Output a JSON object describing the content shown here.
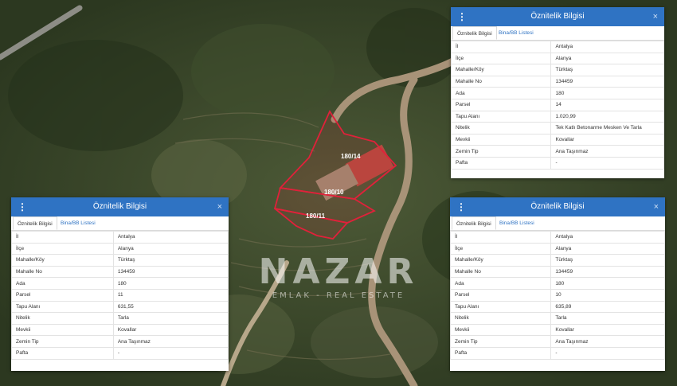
{
  "watermark": {
    "brand": "NAZAR",
    "tagline": "EMLAK - REAL ESTATE"
  },
  "parcel_labels": [
    {
      "id": "180/14",
      "text": "180/14"
    },
    {
      "id": "180/10",
      "text": "180/10"
    },
    {
      "id": "180/11",
      "text": "180/11"
    }
  ],
  "panels": [
    {
      "title": "Öznitelik Bilgisi",
      "tabs": [
        "Öznitelik Bilgisi",
        "Bina/BB Listesi"
      ],
      "rows": [
        {
          "key": "İl",
          "value": "Antalya"
        },
        {
          "key": "İlçe",
          "value": "Alanya"
        },
        {
          "key": "Mahalle/Köy",
          "value": "Türktaş"
        },
        {
          "key": "Mahalle No",
          "value": "134459"
        },
        {
          "key": "Ada",
          "value": "180"
        },
        {
          "key": "Parsel",
          "value": "14"
        },
        {
          "key": "Tapu Alanı",
          "value": "1.020,99"
        },
        {
          "key": "Nitelik",
          "value": "Tek Katlı Betonarme Mesken Ve Tarla"
        },
        {
          "key": "Mevkii",
          "value": "Kovallar"
        },
        {
          "key": "Zemin Tip",
          "value": "Ana Taşınmaz"
        },
        {
          "key": "Pafta",
          "value": "-"
        }
      ]
    },
    {
      "title": "Öznitelik Bilgisi",
      "tabs": [
        "Öznitelik Bilgisi",
        "Bina/BB Listesi"
      ],
      "rows": [
        {
          "key": "İl",
          "value": "Antalya"
        },
        {
          "key": "İlçe",
          "value": "Alanya"
        },
        {
          "key": "Mahalle/Köy",
          "value": "Türktaş"
        },
        {
          "key": "Mahalle No",
          "value": "134459"
        },
        {
          "key": "Ada",
          "value": "180"
        },
        {
          "key": "Parsel",
          "value": "11"
        },
        {
          "key": "Tapu Alanı",
          "value": "631,55"
        },
        {
          "key": "Nitelik",
          "value": "Tarla"
        },
        {
          "key": "Mevkii",
          "value": "Kovallar"
        },
        {
          "key": "Zemin Tip",
          "value": "Ana Taşınmaz"
        },
        {
          "key": "Pafta",
          "value": "-"
        }
      ]
    },
    {
      "title": "Öznitelik Bilgisi",
      "tabs": [
        "Öznitelik Bilgisi",
        "Bina/BB Listesi"
      ],
      "rows": [
        {
          "key": "İl",
          "value": "Antalya"
        },
        {
          "key": "İlçe",
          "value": "Alanya"
        },
        {
          "key": "Mahalle/Köy",
          "value": "Türktaş"
        },
        {
          "key": "Mahalle No",
          "value": "134459"
        },
        {
          "key": "Ada",
          "value": "180"
        },
        {
          "key": "Parsel",
          "value": "10"
        },
        {
          "key": "Tapu Alanı",
          "value": "635,89"
        },
        {
          "key": "Nitelik",
          "value": "Tarla"
        },
        {
          "key": "Mevkii",
          "value": "Kovallar"
        },
        {
          "key": "Zemin Tip",
          "value": "Ana Taşınmaz"
        },
        {
          "key": "Pafta",
          "value": "-"
        }
      ]
    }
  ],
  "colors": {
    "header": "#2f73c3",
    "parcel_outline": "#e0213a",
    "vegetation": "#3c4a2b",
    "road": "#a89378"
  }
}
